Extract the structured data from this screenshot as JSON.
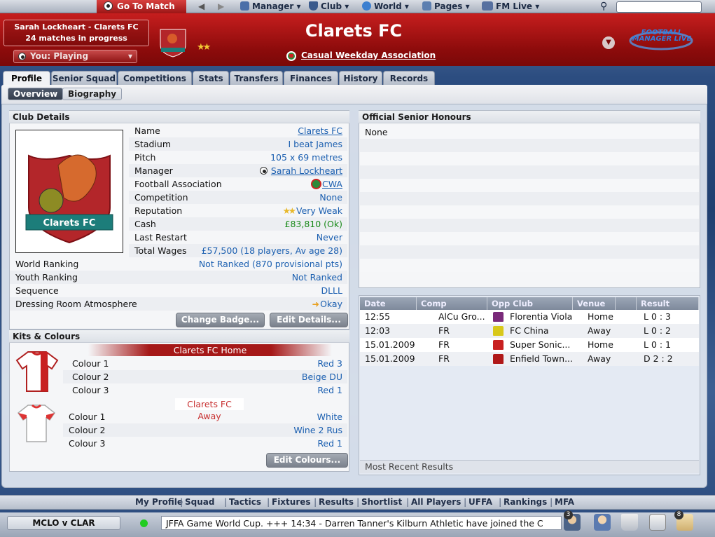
{
  "topbar": {
    "goto_match": "Go To Match",
    "menus": [
      "Manager",
      "Club",
      "World",
      "Pages",
      "FM Live"
    ]
  },
  "header": {
    "manager_line1": "Sarah Lockheart - Clarets FC",
    "manager_line2": "24 matches in progress",
    "playing": "You: Playing",
    "club_name": "Clarets FC",
    "association": "Casual Weekday Association",
    "fm_live_logo": "FOOTBALL MANAGER LIVE"
  },
  "tabs": [
    "Profile",
    "Senior Squad",
    "Competitions",
    "Stats",
    "Transfers",
    "Finances",
    "History",
    "Records"
  ],
  "subtabs": [
    "Overview",
    "Biography"
  ],
  "club_details": {
    "title": "Club Details",
    "badge_text": "Clarets FC",
    "rows": [
      {
        "label": "Name",
        "value": "Clarets FC"
      },
      {
        "label": "Stadium",
        "value": "I beat James"
      },
      {
        "label": "Pitch",
        "value": "105 x 69 metres"
      },
      {
        "label": "Manager",
        "value": "Sarah Lockheart"
      },
      {
        "label": "Football Association",
        "value": "CWA"
      },
      {
        "label": "Competition",
        "value": "None"
      },
      {
        "label": "Reputation",
        "value": "Very Weak"
      },
      {
        "label": "Cash",
        "value": "£83,810 (Ok)"
      },
      {
        "label": "Last Restart",
        "value": "Never"
      },
      {
        "label": "Total Wages",
        "value": "£57,500 (18 players, Av age 28)"
      },
      {
        "label": "World Ranking",
        "value": "Not Ranked (870 provisional pts)"
      },
      {
        "label": "Youth Ranking",
        "value": "Not Ranked"
      },
      {
        "label": "Sequence",
        "value": "DLLL"
      },
      {
        "label": "Dressing Room Atmosphere",
        "value": "Okay"
      }
    ],
    "change_badge": "Change Badge...",
    "edit_details": "Edit Details..."
  },
  "kits": {
    "title": "Kits & Colours",
    "home_title": "Clarets FC Home",
    "away_title": "Clarets FC Away",
    "home": [
      {
        "label": "Colour 1",
        "value": "Red 3"
      },
      {
        "label": "Colour 2",
        "value": "Beige DU"
      },
      {
        "label": "Colour 3",
        "value": "Red 1"
      }
    ],
    "away": [
      {
        "label": "Colour 1",
        "value": "White"
      },
      {
        "label": "Colour 2",
        "value": "Wine 2 Rus"
      },
      {
        "label": "Colour 3",
        "value": "Red 1"
      }
    ],
    "edit_colours": "Edit Colours..."
  },
  "honours": {
    "title": "Official Senior Honours",
    "value": "None"
  },
  "results": {
    "headers": [
      "Date",
      "Comp",
      "Opp Club",
      "Venue",
      "Result"
    ],
    "rows": [
      {
        "date": "12:55",
        "comp": "AlCu Gro...",
        "opp": "Florentia Viola",
        "venue": "Home",
        "result": "L 0 : 3"
      },
      {
        "date": "12:03",
        "comp": "FR",
        "opp": "FC China",
        "venue": "Away",
        "result": "L 0 : 2"
      },
      {
        "date": "15.01.2009",
        "comp": "FR",
        "opp": "Super Sonic...",
        "venue": "Home",
        "result": "L 0 : 1"
      },
      {
        "date": "15.01.2009",
        "comp": "FR",
        "opp": "Enfield Town...",
        "venue": "Away",
        "result": "D 2 : 2"
      }
    ],
    "footer": "Most Recent Results"
  },
  "bottom_nav": [
    "My Profile",
    "Squad",
    "Tactics",
    "Fixtures",
    "Results",
    "Shortlist",
    "All Players",
    "UFFA",
    "Rankings",
    "MFA"
  ],
  "status": {
    "score": "MCLO v CLAR",
    "ticker": "JFFA Game World Cup.   +++   14:34 - Darren Tanner's Kilburn Athletic have joined the C",
    "badge1": "3",
    "badge2": "8"
  },
  "colors": {
    "header_red": "#b01515",
    "link_blue": "#1b5fb0",
    "cash_green": "#1a8a1a"
  }
}
